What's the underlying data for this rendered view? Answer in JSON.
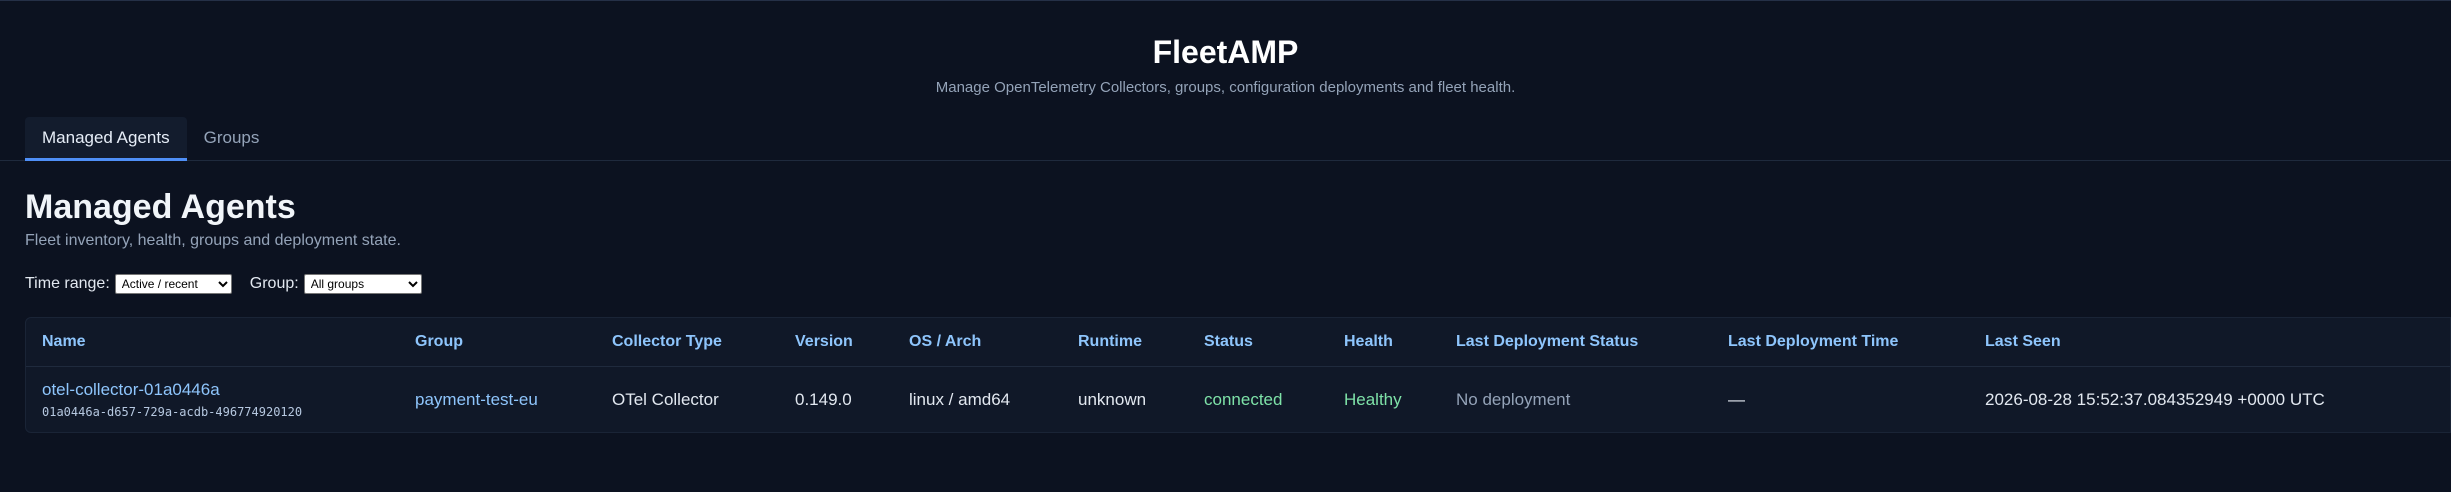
{
  "app": {
    "title": "FleetAMP",
    "subtitle": "Manage OpenTelemetry Collectors, groups, configuration deployments and fleet health."
  },
  "tabs": [
    {
      "label": "Managed Agents",
      "active": true
    },
    {
      "label": "Groups",
      "active": false
    }
  ],
  "page": {
    "title": "Managed Agents",
    "subtitle": "Fleet inventory, health, groups and deployment state."
  },
  "filters": {
    "time_range_label": "Time range:",
    "time_range_value": "Active / recent",
    "group_label": "Group:",
    "group_value": "All groups"
  },
  "table": {
    "columns": [
      "Name",
      "Group",
      "Collector Type",
      "Version",
      "OS / Arch",
      "Runtime",
      "Status",
      "Health",
      "Last Deployment Status",
      "Last Deployment Time",
      "Last Seen"
    ],
    "rows": [
      {
        "name": "otel-collector-01a0446a",
        "id": "01a0446a-d657-729a-acdb-496774920120",
        "group": "payment-test-eu",
        "collector_type": "OTel Collector",
        "version": "0.149.0",
        "os_arch": "linux / amd64",
        "runtime": "unknown",
        "status": "connected",
        "health": "Healthy",
        "last_deployment_status": "No deployment",
        "last_deployment_time": "—",
        "last_seen": "2026-08-28 15:52:37.084352949 +0000 UTC"
      }
    ]
  },
  "colors": {
    "background": "#0c1220",
    "accent": "#4f8ff7",
    "link": "#8ec5fc",
    "status_ok": "#7ee2a8"
  }
}
